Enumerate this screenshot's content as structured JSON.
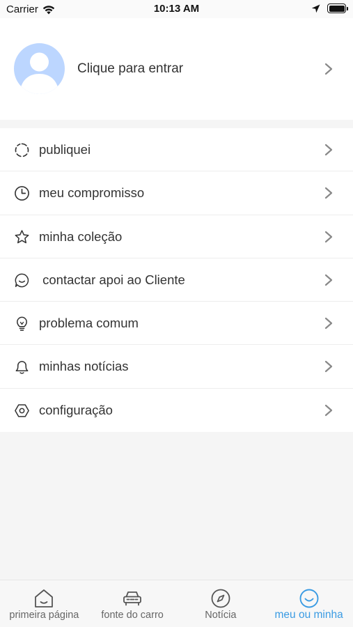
{
  "status_bar": {
    "carrier": "Carrier",
    "time": "10:13 AM"
  },
  "profile": {
    "login_prompt": "Clique para entrar"
  },
  "menu": {
    "items": [
      {
        "label": "publiquei",
        "icon": "loading-circle-icon"
      },
      {
        "label": "meu compromisso",
        "icon": "clock-icon"
      },
      {
        "label": "minha coleção",
        "icon": "star-icon"
      },
      {
        "label": " contactar apoi ao Cliente",
        "icon": "chat-bubble-icon"
      },
      {
        "label": "problema comum",
        "icon": "lightbulb-icon"
      },
      {
        "label": "minhas notícias",
        "icon": "bell-icon"
      },
      {
        "label": "configuração",
        "icon": "settings-hexagon-icon"
      }
    ]
  },
  "tabbar": {
    "tabs": [
      {
        "label": "primeira página",
        "icon": "home-icon",
        "active": false
      },
      {
        "label": "fonte do carro",
        "icon": "car-icon",
        "active": false
      },
      {
        "label": "Notícia",
        "icon": "compass-icon",
        "active": false
      },
      {
        "label": "meu ou minha",
        "icon": "smiley-icon",
        "active": true
      }
    ],
    "active_color": "#3a9be3",
    "inactive_color": "#666666"
  },
  "colors": {
    "avatar_bg": "#bcd6ff",
    "page_bg": "#f5f5f5"
  }
}
